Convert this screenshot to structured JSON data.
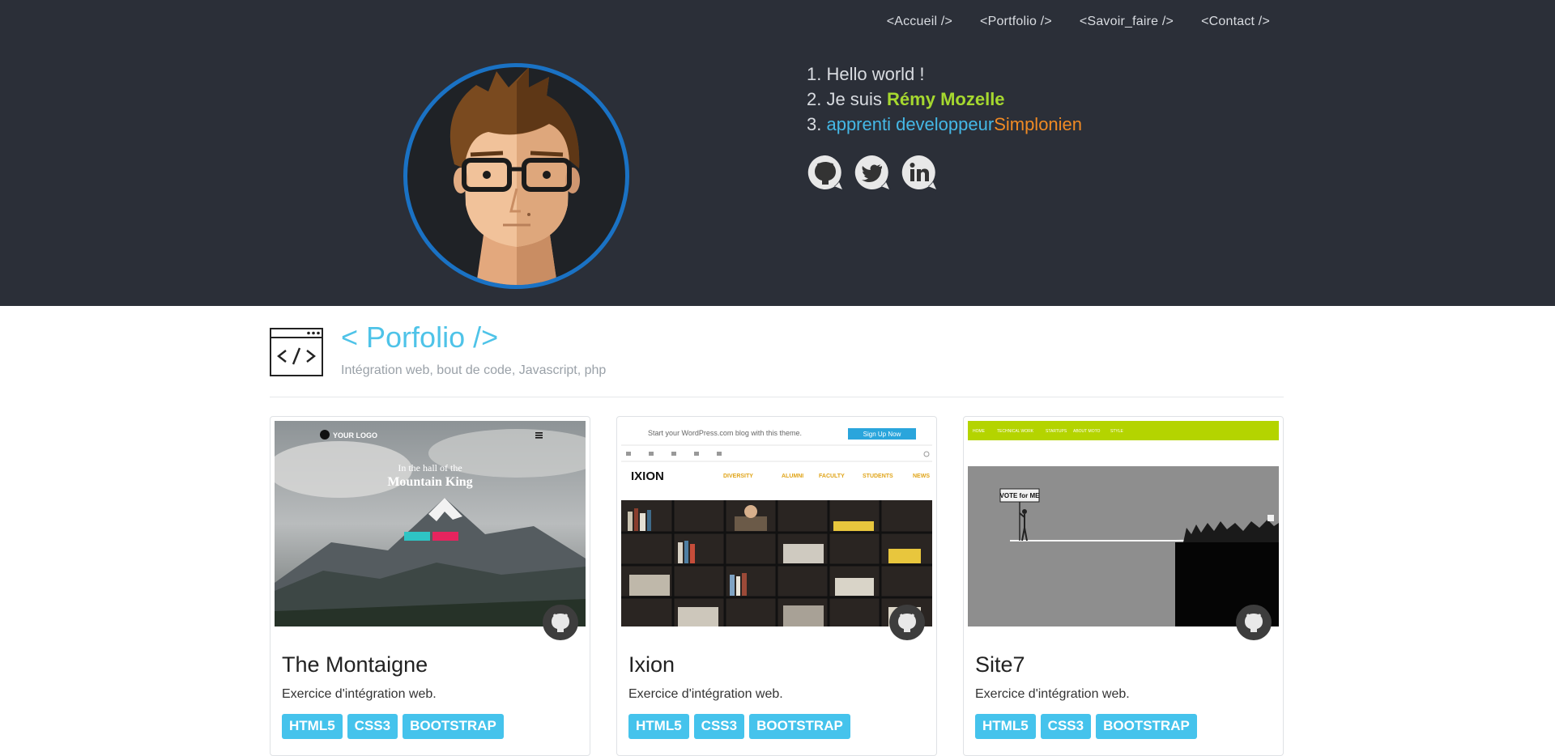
{
  "nav": {
    "items": [
      "<Accueil />",
      "<Portfolio />",
      "<Savoir_faire />",
      "<Contact />"
    ]
  },
  "intro": {
    "line1": "1. Hello world !",
    "line2_prefix": "2. Je suis ",
    "name": "Rémy Mozelle",
    "line3_prefix": "3. ",
    "role": "apprenti developpeur",
    "school": "Simplonien"
  },
  "socials": [
    "github-icon",
    "twitter-icon",
    "linkedin-icon"
  ],
  "portfolio": {
    "title": "< Porfolio />",
    "subtitle": "Intégration web, bout de code, Javascript, php"
  },
  "cards": [
    {
      "title": "The Montaigne",
      "desc": "Exercice d'intégration web.",
      "tags": [
        "HTML5",
        "CSS3",
        "BOOTSTRAP"
      ],
      "thumb": {
        "logo": "YOUR LOGO",
        "line1": "In the hall of the",
        "line2": "Mountain King"
      }
    },
    {
      "title": "Ixion",
      "desc": "Exercice d'intégration web.",
      "tags": [
        "HTML5",
        "CSS3",
        "BOOTSTRAP"
      ],
      "thumb": {
        "banner": "Start your WordPress.com blog with this theme.",
        "button": "Sign Up Now",
        "brand": "IXION",
        "menu": [
          "DIVERSITY",
          "ALUMNI",
          "FACULTY",
          "STUDENTS",
          "NEWS"
        ]
      }
    },
    {
      "title": "Site7",
      "desc": "Exercice d'intégration web.",
      "tags": [
        "HTML5",
        "CSS3",
        "BOOTSTRAP"
      ],
      "thumb": {
        "menu": [
          "HOME",
          "TECHNICAL WORK",
          "STARTUPS",
          "ABOUT MOTO",
          "STYLE"
        ],
        "sign": "VOTE for ME"
      }
    }
  ],
  "colors": {
    "header_bg": "#2b2f38",
    "accent_blue": "#45c3ec",
    "name_green": "#a6d82f",
    "school_orange": "#f08a24",
    "avatar_ring": "#1a72c4"
  }
}
